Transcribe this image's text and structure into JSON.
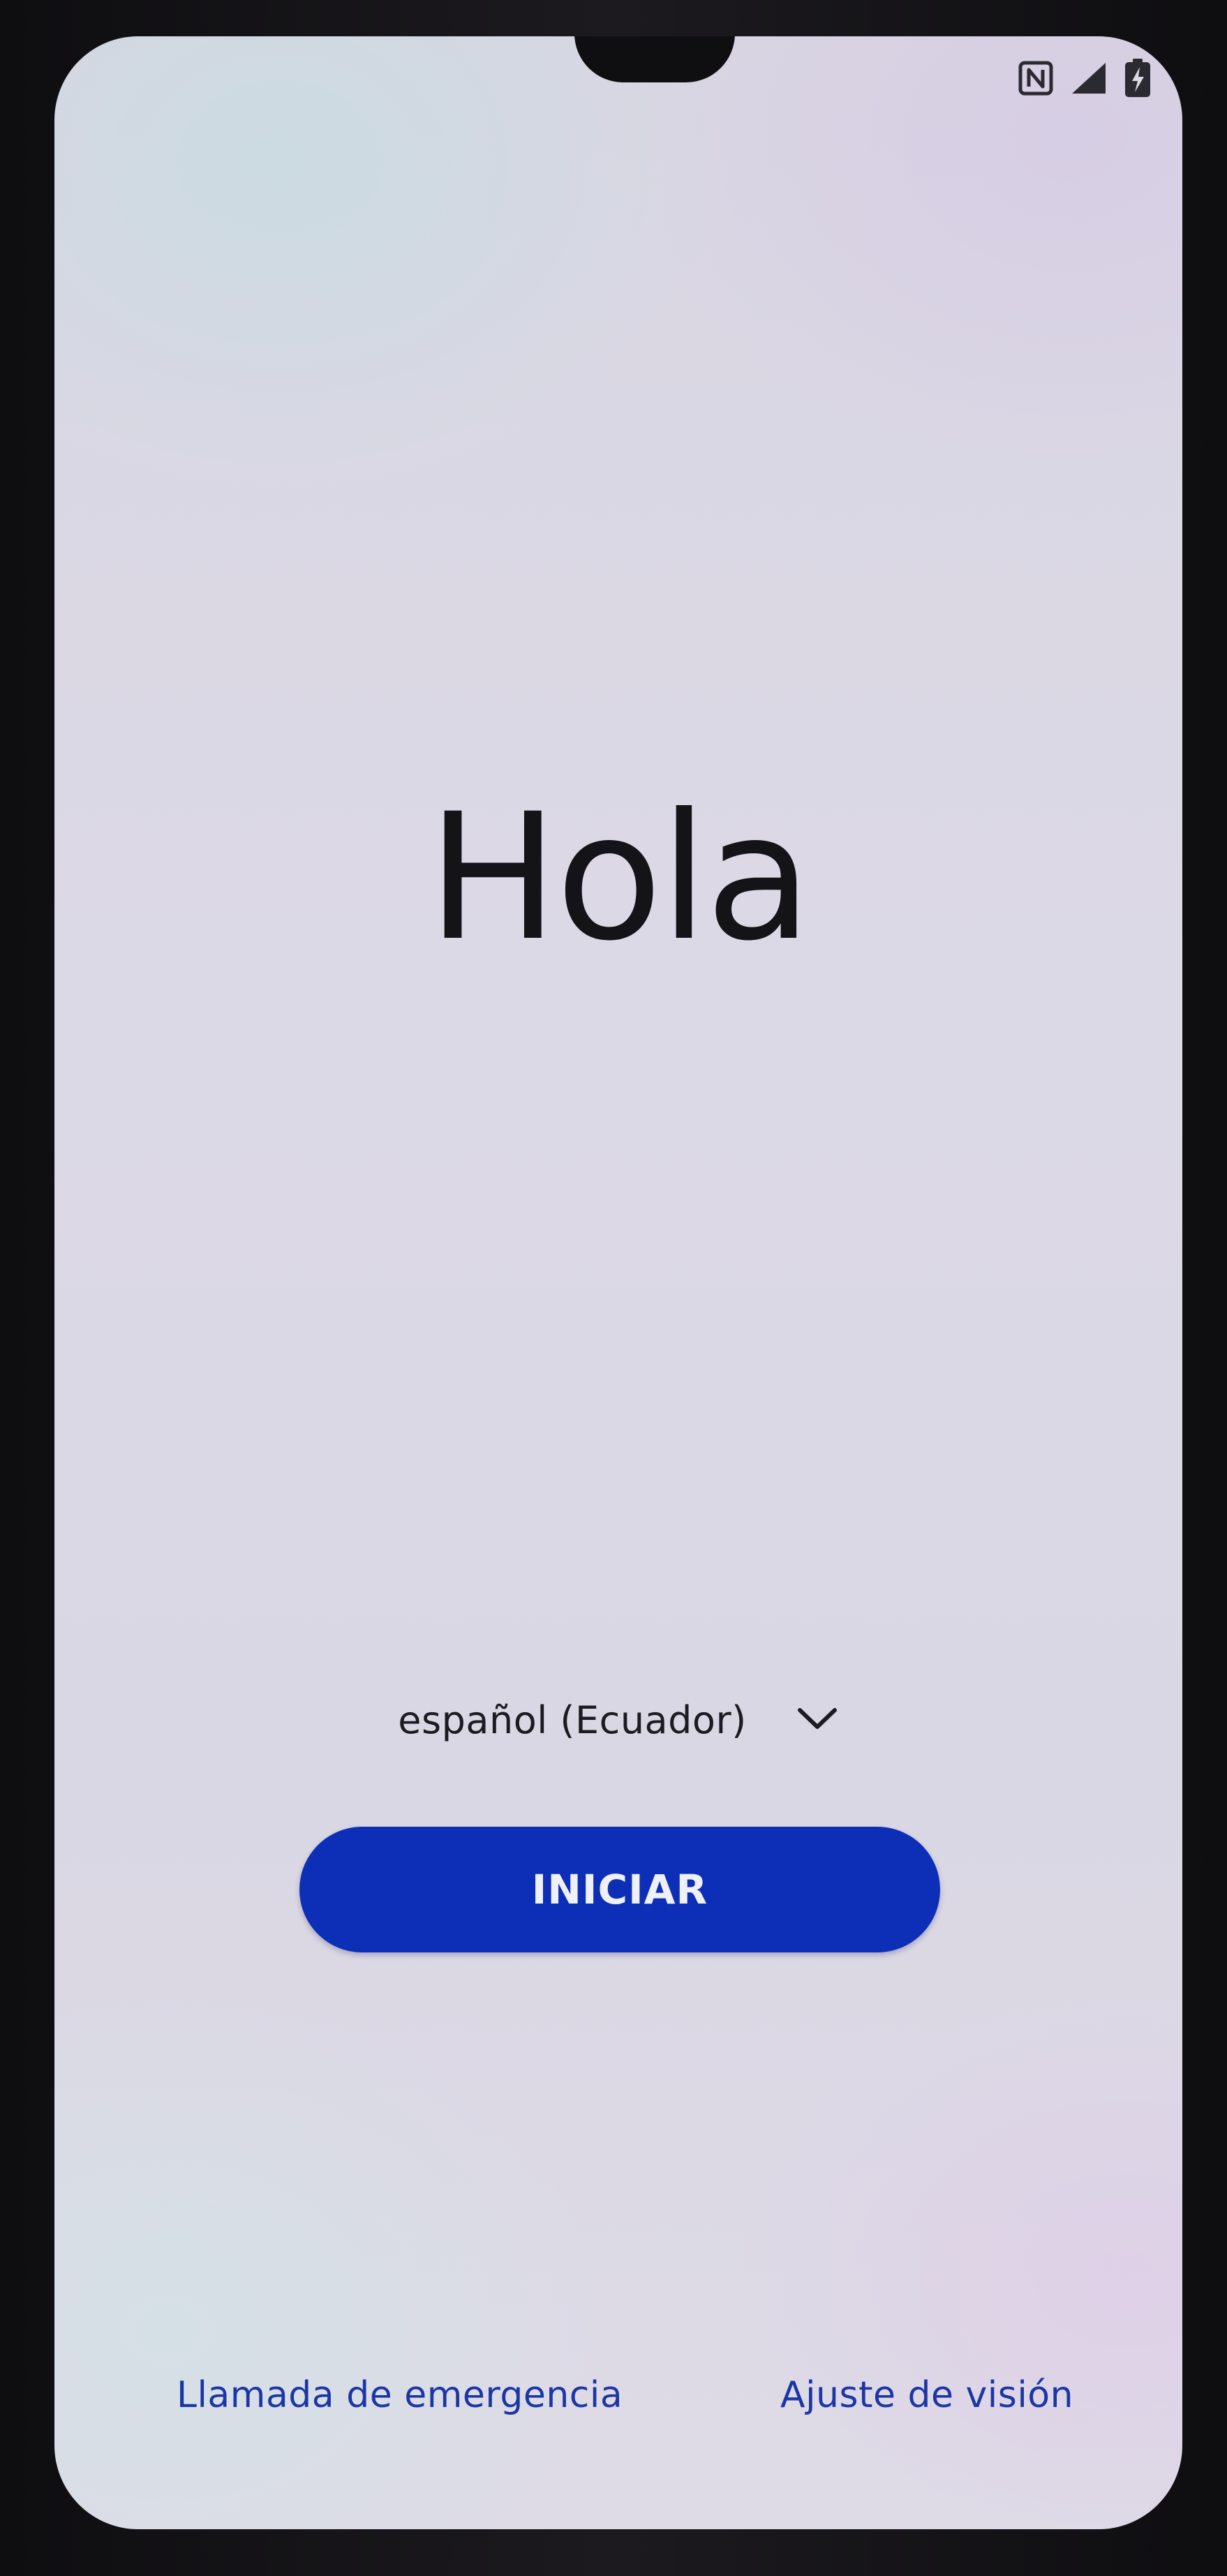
{
  "status_bar": {
    "icons": [
      "nfc-icon",
      "signal-icon",
      "battery-charging-icon"
    ]
  },
  "welcome": {
    "greeting": "Hola"
  },
  "language": {
    "selected": "español (Ecuador)",
    "icon": "chevron-down-icon"
  },
  "actions": {
    "start_label": "INICIAR",
    "emergency_call_label": "Llamada de emergencia",
    "vision_settings_label": "Ajuste de visión"
  },
  "colors": {
    "accent": "#0d2fb8",
    "link": "#1c36a6",
    "background": "#dad7e4",
    "text": "#141318"
  }
}
